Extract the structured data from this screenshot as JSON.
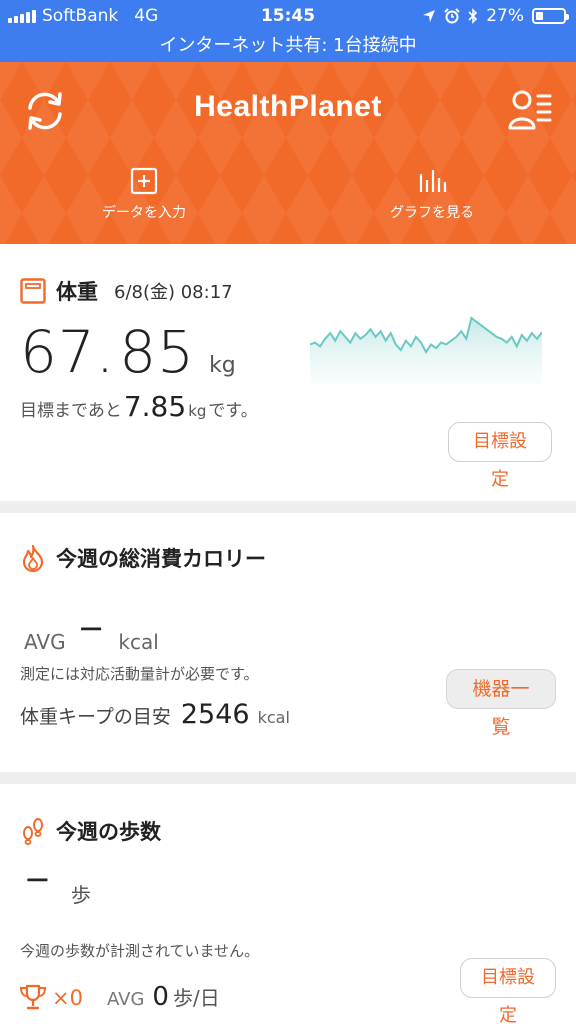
{
  "status_bar": {
    "carrier": "SoftBank",
    "network": "4G",
    "time": "15:45",
    "battery": "27%",
    "battery_level": 0.27
  },
  "hotspot_banner": "インターネット共有: 1台接続中",
  "header": {
    "title": "HealthPlanet",
    "actions": {
      "input": "データを入力",
      "graph": "グラフを見る"
    }
  },
  "weight": {
    "title": "体重",
    "date": "6/8(金) 08:17",
    "value_int": "67.",
    "value_dec": "85",
    "unit": "kg",
    "goal_prefix": "目標まであと",
    "goal_value": "7.85",
    "goal_unit": "kg",
    "goal_suffix": "です。",
    "goal_button": "目標設定",
    "trend": [
      67.2,
      67.3,
      67.1,
      67.5,
      67.8,
      67.4,
      67.9,
      67.6,
      67.3,
      67.8,
      67.5,
      67.7,
      68.0,
      67.6,
      67.9,
      67.4,
      67.8,
      67.2,
      66.9,
      67.4,
      67.1,
      67.6,
      67.3,
      66.8,
      67.2,
      67.0,
      67.3,
      67.2,
      67.4,
      67.6,
      67.9,
      67.5,
      68.6,
      68.4,
      68.2,
      68.0,
      67.8,
      67.6,
      67.5,
      67.3,
      67.6,
      67.1,
      67.7,
      67.4,
      67.8,
      67.5,
      67.85
    ]
  },
  "calories": {
    "title": "今週の総消費カロリー",
    "avg_label": "AVG",
    "avg_value": "−",
    "avg_unit": "kcal",
    "note": "測定には対応活動量計が必要です。",
    "keep_label": "体重キープの目安",
    "keep_value": "2546",
    "keep_unit": "kcal",
    "device_button": "機器一覧"
  },
  "steps": {
    "title": "今週の歩数",
    "value": "−",
    "unit": "歩",
    "note": "今週の歩数が計測されていません。",
    "goal_button": "目標設定",
    "trophy_count": "×0",
    "avg_label": "AVG",
    "avg_value": "0",
    "avg_unit": "歩/日"
  },
  "colors": {
    "accent": "#f26a2a",
    "status_bar": "#3d7df0",
    "trend_line": "#6cc8c4"
  }
}
